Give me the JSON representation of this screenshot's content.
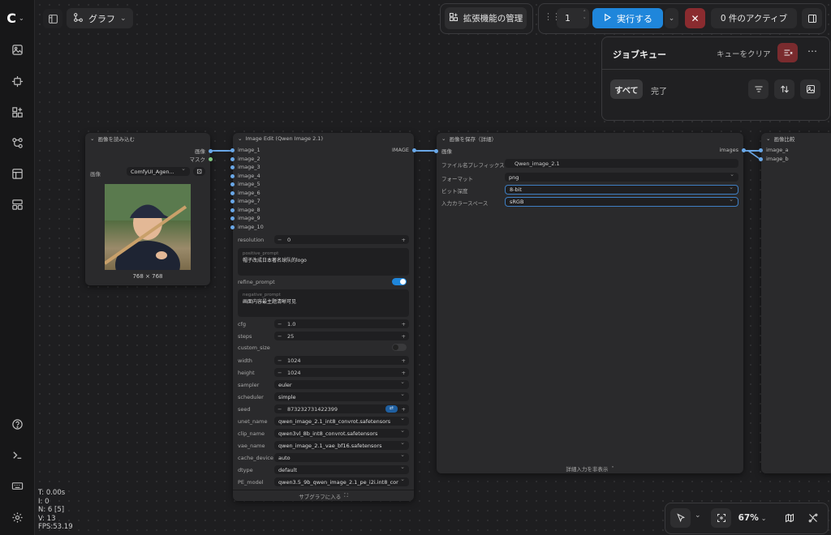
{
  "topbar": {
    "graph_label": "グラフ",
    "extensions_label": "拡張機能の管理",
    "queue_count": "1",
    "run_label": "実行する",
    "active_label": "0 件のアクティブ"
  },
  "queue": {
    "title": "ジョブキュー",
    "clear_label": "キューをクリア",
    "tab_all": "すべて",
    "tab_done": "完了"
  },
  "load_node": {
    "title": "画像を読み込む",
    "out_image": "画像",
    "out_mask": "マスク",
    "image_label": "画像",
    "image_value": "ComfyUI_Agen...",
    "size": "768 × 768"
  },
  "edit_node": {
    "title": "Image Edit (Qwen Image 2.1)",
    "inputs": [
      "image_1",
      "image_2",
      "image_3",
      "image_4",
      "image_5",
      "image_6",
      "image_7",
      "image_8",
      "image_9",
      "image_10"
    ],
    "output": "IMAGE",
    "resolution_label": "resolution",
    "resolution_value": "0",
    "pos_placeholder": "positive_prompt",
    "pos_text": "帽子改成日本著名球队的logo",
    "refine_label": "refine_prompt",
    "neg_placeholder": "negative_prompt",
    "neg_text": "画面内容最主题清晰可见",
    "cfg_label": "cfg",
    "cfg_value": "1.0",
    "steps_label": "steps",
    "steps_value": "25",
    "custom_size_label": "custom_size",
    "width_label": "width",
    "width_value": "1024",
    "height_label": "height",
    "height_value": "1024",
    "sampler_label": "sampler",
    "sampler_value": "euler",
    "scheduler_label": "scheduler",
    "scheduler_value": "simple",
    "seed_label": "seed",
    "seed_value": "873232731422399",
    "unet_label": "unet_name",
    "unet_value": "qwen_image_2.1_int8_convrot.safetensors",
    "clip_label": "clip_name",
    "clip_value": "qwen3vl_8b_int8_convrot.safetensors",
    "vae_label": "vae_name",
    "vae_value": "qwen_image_2.1_vae_bf16.safetensors",
    "cache_label": "cache_device",
    "cache_value": "auto",
    "dtype_label": "dtype",
    "dtype_value": "default",
    "pe_label": "PE_model",
    "pe_value": "qwen3.5_9b_qwen_image_2.1_pe_i2i.int8_conv...",
    "subgraph_label": "サブグラフに入る"
  },
  "save_node": {
    "title": "画像を保存（詳細）",
    "in_image": "画像",
    "out_images": "images",
    "prefix_label": "ファイル名プレフィックス",
    "prefix_value": "Qwen_image_2.1",
    "format_label": "フォーマット",
    "format_value": "png",
    "bitdepth_label": "ビット深度",
    "bitdepth_value": "8-bit",
    "colorspace_label": "入力カラースペース",
    "colorspace_value": "sRGB",
    "hide_label": "詳細入力を非表示"
  },
  "compare_node": {
    "title": "画像比較",
    "in_a": "image_a",
    "in_b": "image_b"
  },
  "bottombar": {
    "zoom": "67%"
  },
  "stats": {
    "t": "T: 0.00s",
    "i": "I: 0",
    "n": "N: 6 [5]",
    "v": "V: 13",
    "fps": "FPS:53.19"
  }
}
